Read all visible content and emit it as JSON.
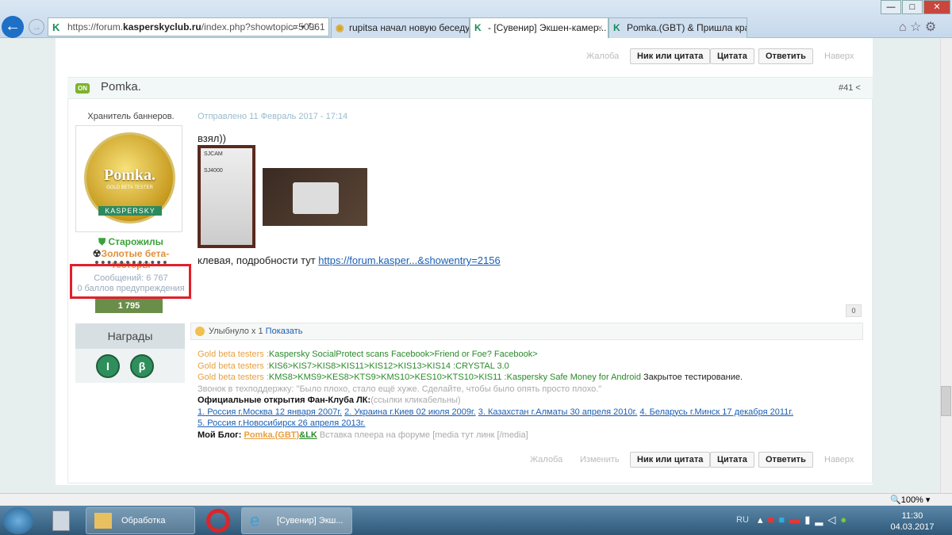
{
  "browser": {
    "address": {
      "prefix": "https://forum.",
      "domain": "kasperskyclub.ru",
      "path": "/index.php?showtopic=50961"
    },
    "tabs": [
      {
        "label": "rupitsa начал новую беседу с ..."
      },
      {
        "label": "- [Сувенир] Экшен-камер...",
        "close": "×"
      },
      {
        "label": "Pomka.(GBT) & Пришла крас..."
      }
    ],
    "zoom": "100%"
  },
  "post_actions": {
    "report": "Жалоба",
    "nick_quote": "Ник или цитата",
    "quote": "Цитата",
    "reply": "Ответить",
    "top": "Наверх",
    "edit": "Изменить"
  },
  "post": {
    "status_badge": "ON",
    "author": "Pomka.",
    "number": "#41",
    "user_title": "Хранитель баннеров.",
    "avatar": {
      "name": "Pomka.",
      "subtitle": "GOLD BETA TESTER",
      "brand": "KASPERSKY"
    },
    "groups": [
      "Старожилы",
      "Золотые бета-тестеры"
    ],
    "posts_count": "Сообщений: 6 767",
    "warnings": "0 баллов предупреждения",
    "reputation": "1 795",
    "awards_title": "Награды",
    "awards": [
      "I",
      "β"
    ],
    "date": "Отправлено 11 Февраль 2017 - 17:14",
    "text1": "взял))",
    "text2": "клевая, подробности тут ",
    "link": "https://forum.kasper...&showentry=2156",
    "rep_count": "0",
    "reaction": {
      "label": "Улыбнуло x ",
      "count": "1",
      "show": "Показать"
    }
  },
  "signature": {
    "gbt": "Gold beta testers :",
    "l1": "Kaspersky SocialProtect scans Facebook>Friend or Foe? Facebook>",
    "l2": "KIS6>KIS7>KIS8>KIS11>KIS12>KIS13>KIS14 :CRYSTAL 3.0",
    "l3": "KMS8>KMS9>KES8>KTS9>KMS10>KES10>KTS10>KIS11 :Kaspersky Safe Money for Android",
    "l3b": " Закрытое тестирование.",
    "l4": "Звонок в техподдержку: \"Было плохо, стало ещё хуже. Сделайте, чтобы было опять просто плохо.\"",
    "l5": "Официальные открытия Фан-Клуба ЛК:",
    "l5b": "(ссылки кликабельны)",
    "links": [
      "1. Россия г.Москва 12 января 2007г.",
      "2. Украина г.Киев 02 июля 2009г.",
      "3. Казахстан г.Алматы 30 апреля 2010г.",
      "4. Беларусь г.Минск 17 декабря 2011г.",
      "5. Россия г.Новосибирск 26 апреля 2013г."
    ],
    "blog": "Мой Блог: ",
    "blog_link1": "Pomka.(GBT)",
    "blog_link2": "&LK",
    "blog_tail": " Вставка плеера на форуме [media тут линк [/media]"
  },
  "taskbar": {
    "items": [
      "Обработка",
      "[Сувенир] Экш..."
    ],
    "lang": "RU",
    "time": "11:30",
    "date": "04.03.2017"
  }
}
